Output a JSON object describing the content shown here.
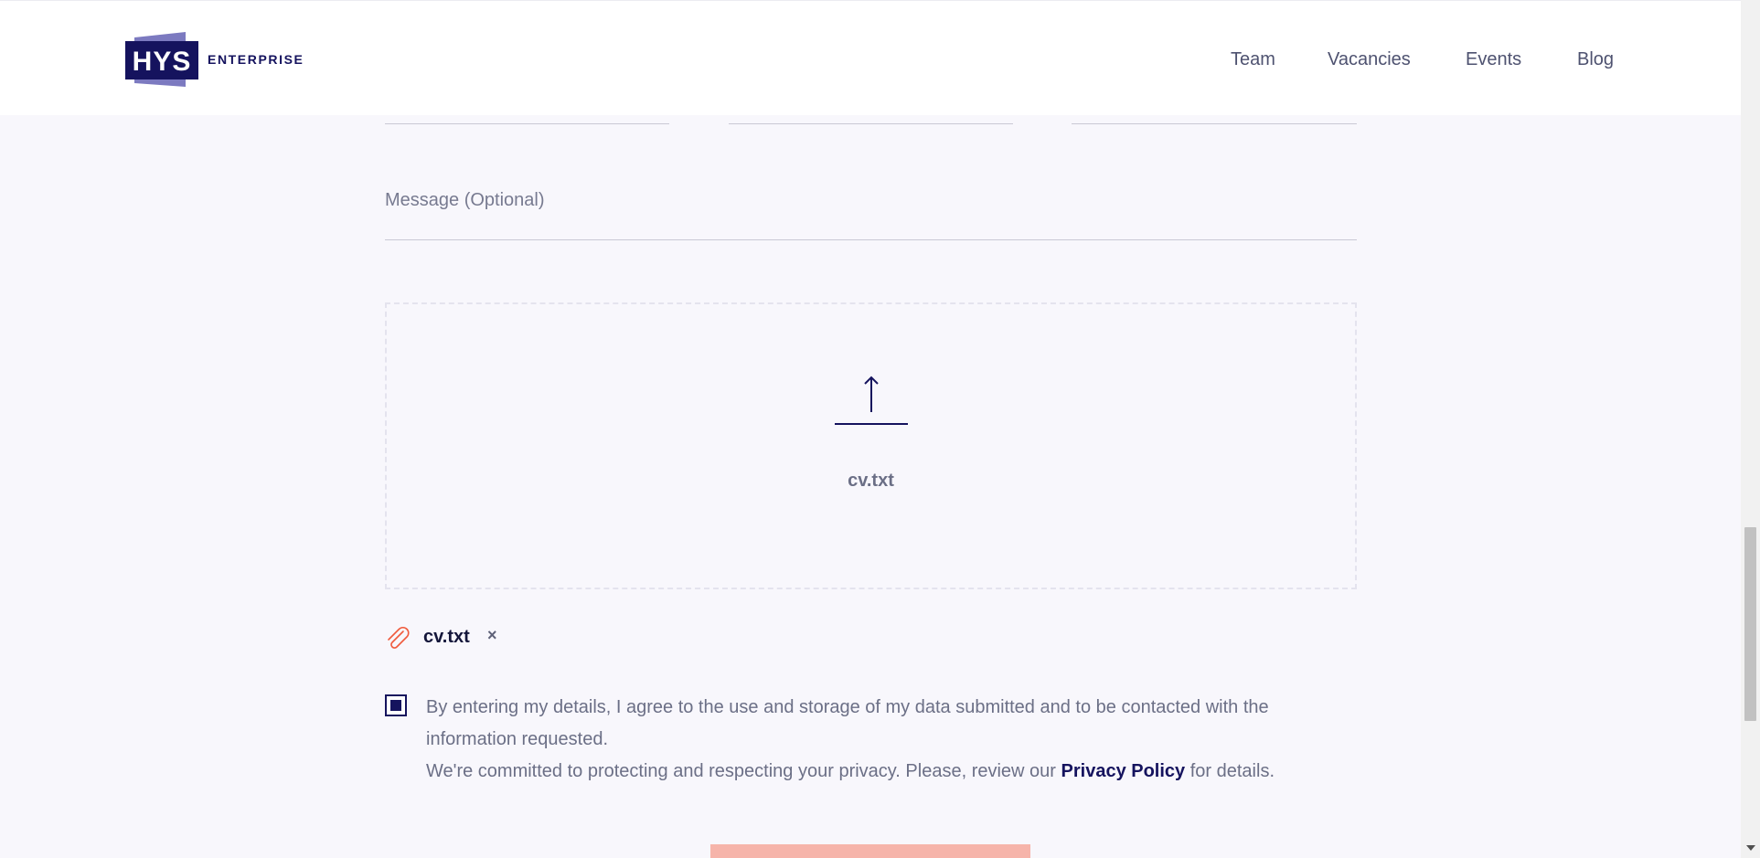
{
  "header": {
    "logo_mark": "HYS",
    "logo_word": "ENTERPRISE",
    "nav": [
      "Team",
      "Vacancies",
      "Events",
      "Blog"
    ]
  },
  "form": {
    "message_placeholder": "Message (Optional)",
    "dropzone": {
      "icon": "upload-arrow-icon",
      "filename": "cv.txt"
    },
    "attachment": {
      "icon": "paperclip-icon",
      "filename": "cv.txt",
      "remove": "×"
    },
    "consent": {
      "checked": true,
      "line1": "By entering my details, I agree to the use and storage of my data submitted and to be contacted with the information requested.",
      "line2_before": "We're committed to protecting and respecting your privacy. Please, review our ",
      "privacy_link": "Privacy Policy",
      "line2_after": " for details."
    }
  },
  "colors": {
    "brand_navy": "#15135e",
    "brand_lavender": "#7c7ac0",
    "accent_coral": "#f05a3c",
    "submit_bg": "#f6b4aa",
    "page_bg": "#f8f7fc"
  }
}
